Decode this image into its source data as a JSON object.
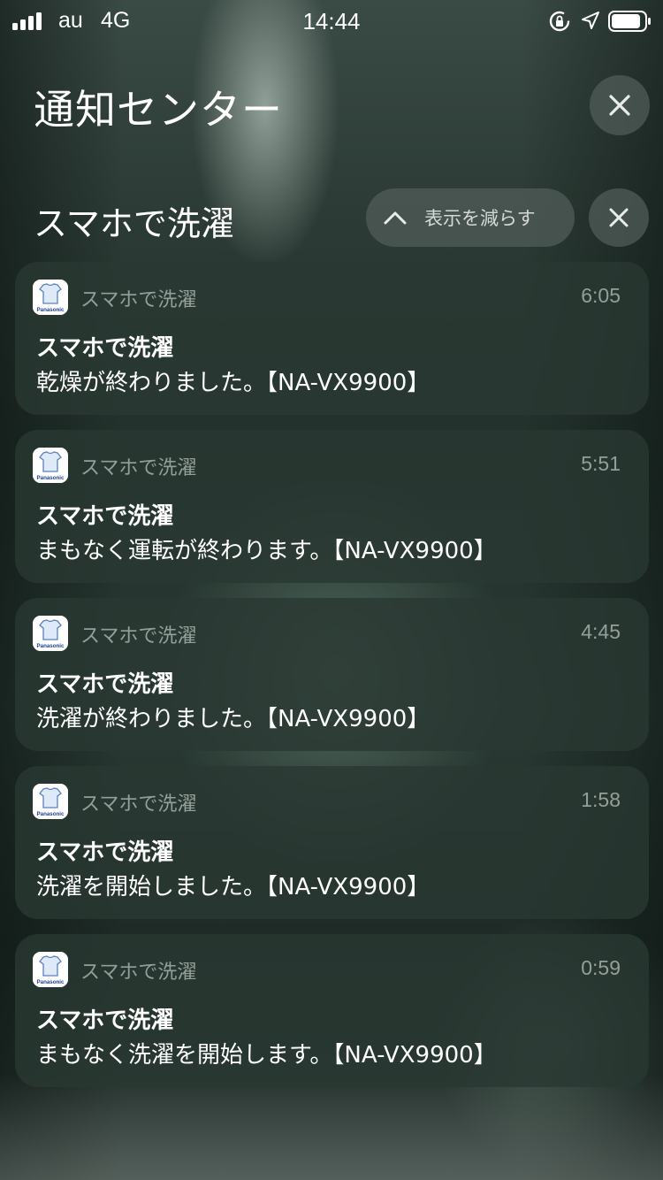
{
  "status_bar": {
    "carrier": "au",
    "network": "4G",
    "time": "14:44",
    "icons": [
      "signal-bars-icon",
      "orientation-lock-icon",
      "location-arrow-icon",
      "battery-icon"
    ]
  },
  "header": {
    "title": "通知センター",
    "close_icon": "close-icon"
  },
  "group": {
    "title": "スマホで洗濯",
    "show_less_label": "表示を減らす",
    "chevron_icon": "chevron-up-icon",
    "close_icon": "close-icon"
  },
  "notifications": [
    {
      "app_name": "スマホで洗濯",
      "time": "6:05",
      "title": "スマホで洗濯",
      "body": "乾燥が終わりました。【NA-VX9900】",
      "icon_text": "Panasonic"
    },
    {
      "app_name": "スマホで洗濯",
      "time": "5:51",
      "title": "スマホで洗濯",
      "body": "まもなく運転が終わります。【NA-VX9900】",
      "icon_text": "Panasonic"
    },
    {
      "app_name": "スマホで洗濯",
      "time": "4:45",
      "title": "スマホで洗濯",
      "body": "洗濯が終わりました。【NA-VX9900】",
      "icon_text": "Panasonic"
    },
    {
      "app_name": "スマホで洗濯",
      "time": "1:58",
      "title": "スマホで洗濯",
      "body": "洗濯を開始しました。【NA-VX9900】",
      "icon_text": "Panasonic"
    },
    {
      "app_name": "スマホで洗濯",
      "time": "0:59",
      "title": "スマホで洗濯",
      "body": "まもなく洗濯を開始します。【NA-VX9900】",
      "icon_text": "Panasonic"
    }
  ],
  "colors": {
    "card_bg": "#2a3832",
    "pill_bg": "#505c58",
    "muted_text": "#dce4e0"
  }
}
